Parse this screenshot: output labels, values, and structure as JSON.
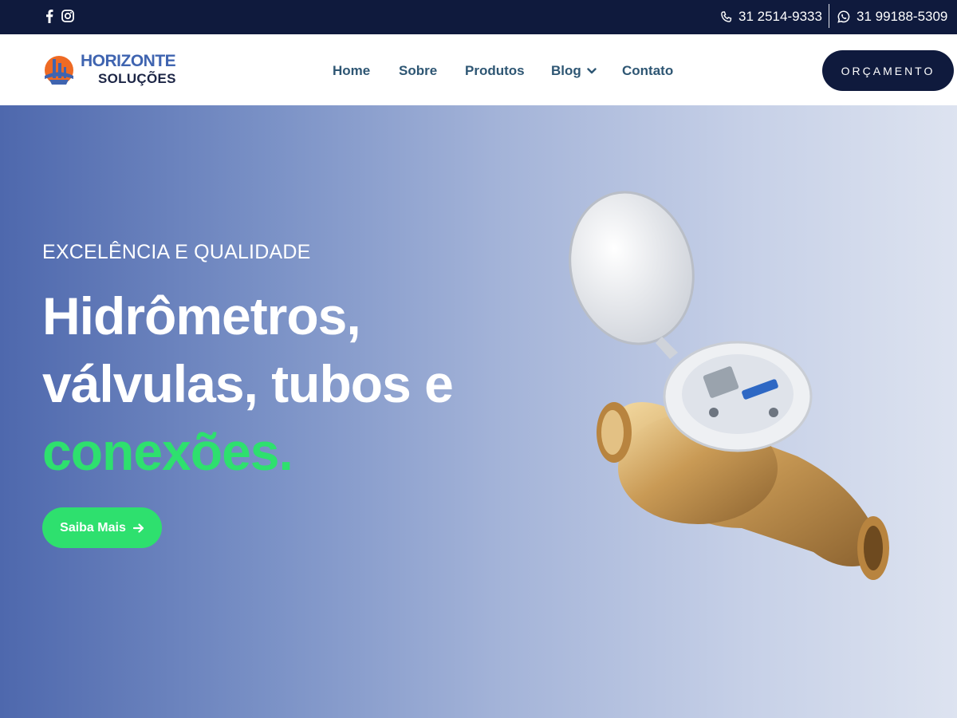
{
  "topbar": {
    "social": {
      "facebook_icon": "facebook-icon",
      "instagram_icon": "instagram-icon"
    },
    "phone": "31 2514-9333",
    "whatsapp": "31 99188-5309"
  },
  "header": {
    "logo": {
      "line1": "HORIZONTE",
      "line2": "SOLUÇÕES"
    },
    "nav": [
      {
        "label": "Home"
      },
      {
        "label": "Sobre"
      },
      {
        "label": "Produtos"
      },
      {
        "label": "Blog",
        "has_dropdown": true
      },
      {
        "label": "Contato"
      }
    ],
    "cta_label": "ORÇAMENTO"
  },
  "hero": {
    "eyebrow": "EXCELÊNCIA E QUALIDADE",
    "headline_line1": "Hidrômetros,",
    "headline_line2": "válvulas, tubos e",
    "headline_accent": "conexões.",
    "button_label": "Saiba Mais",
    "product_image": "water-meter-image"
  },
  "colors": {
    "navy": "#0f1a3d",
    "accent_green": "#2ee06e",
    "nav_text": "#2e5673",
    "logo_blue": "#3f64b0",
    "hero_gradient_start": "#4e68ad",
    "hero_gradient_end": "#dde3f0"
  }
}
